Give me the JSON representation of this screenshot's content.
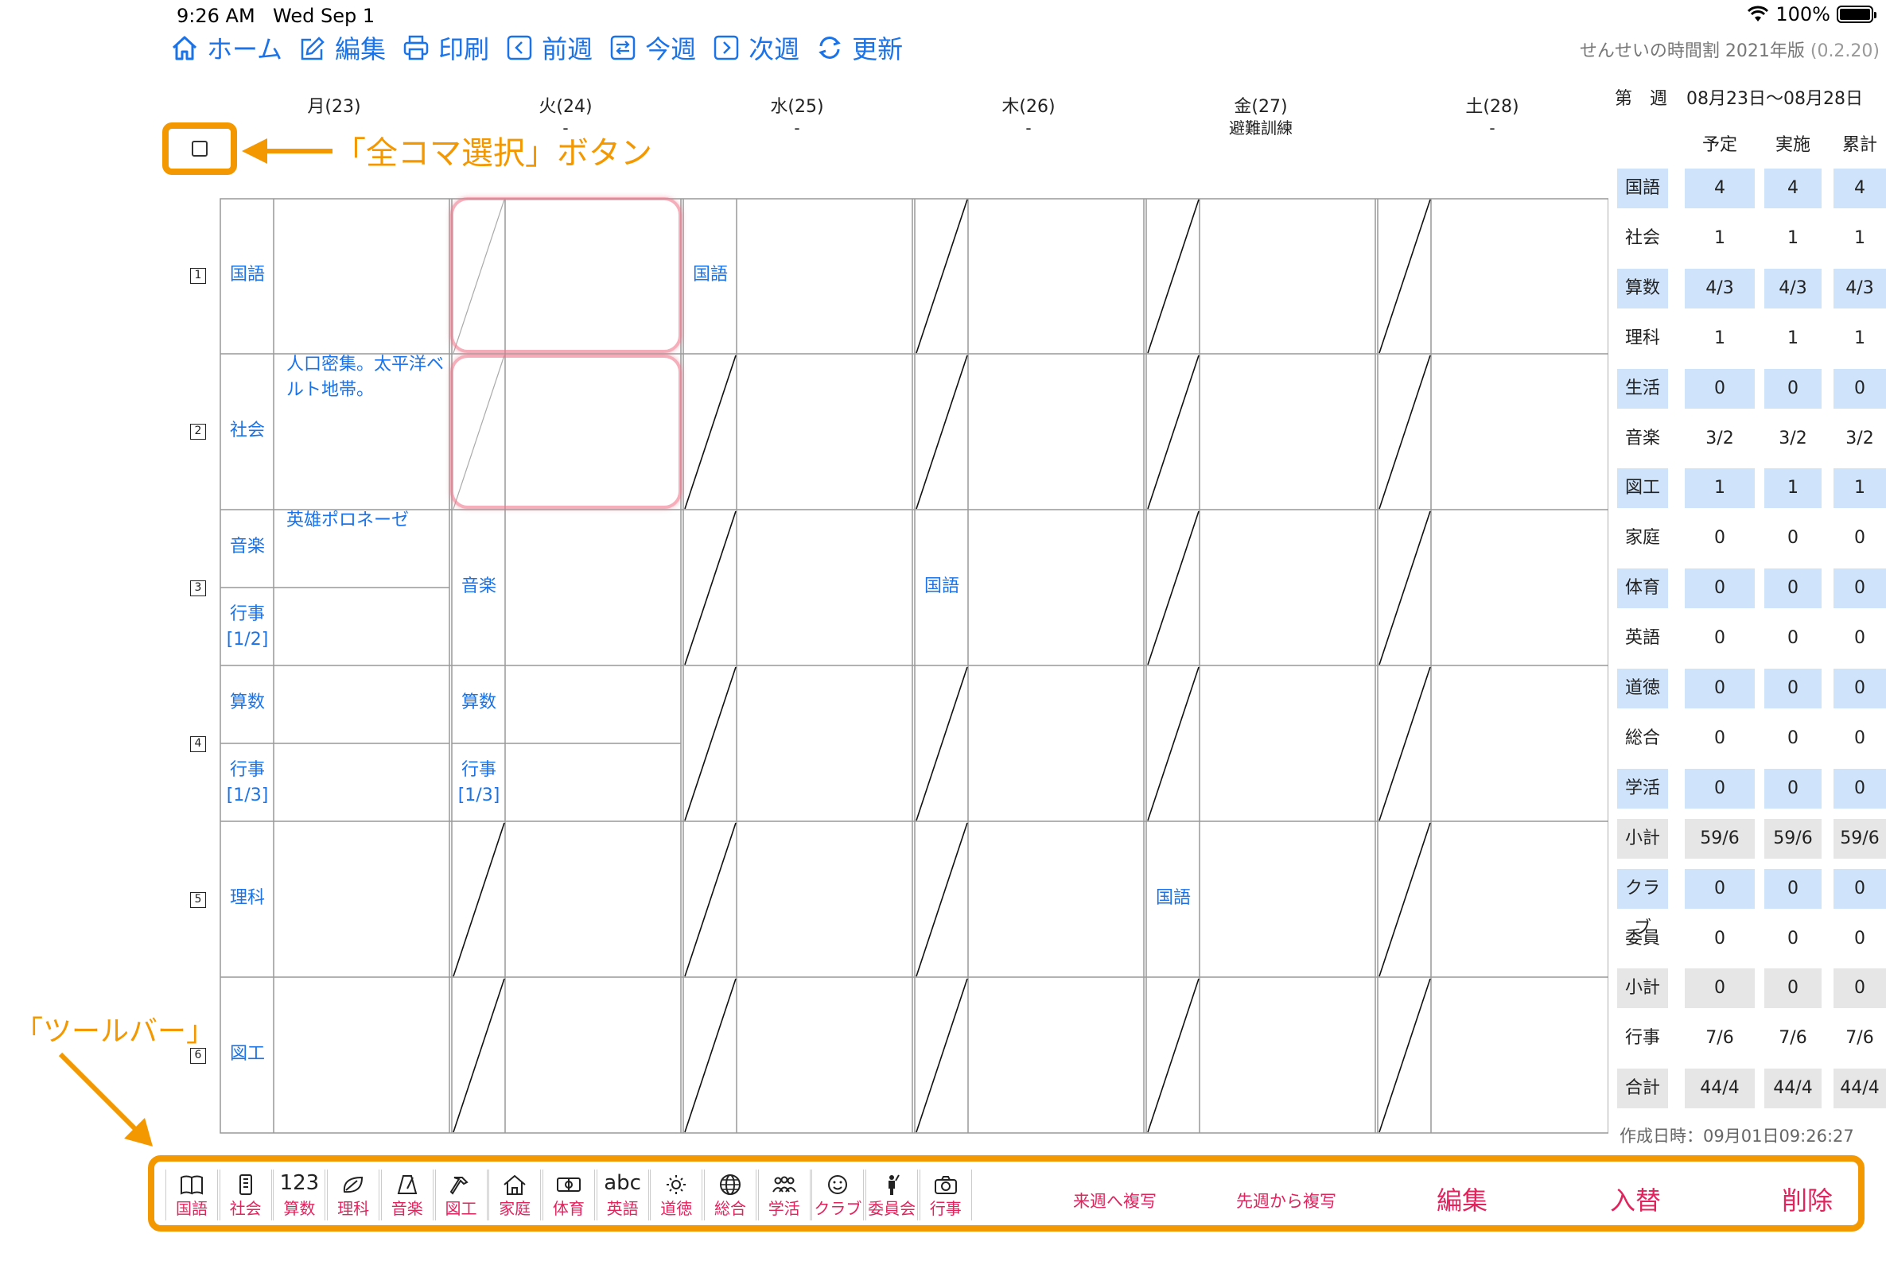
{
  "status": {
    "time": "9:26 AM",
    "date": "Wed Sep 1",
    "battery": "100%"
  },
  "nav": {
    "home": "ホーム",
    "edit": "編集",
    "print": "印刷",
    "prev": "前週",
    "this": "今週",
    "next": "次週",
    "refresh": "更新"
  },
  "app": {
    "name": "せんせいの時間割 2021年版",
    "version": "(0.2.20)"
  },
  "days": [
    {
      "label": "月(23)",
      "note": ""
    },
    {
      "label": "火(24)",
      "note": "-"
    },
    {
      "label": "水(25)",
      "note": "-"
    },
    {
      "label": "木(26)",
      "note": "-"
    },
    {
      "label": "金(27)",
      "note": "避難訓練"
    },
    {
      "label": "土(28)",
      "note": "-"
    }
  ],
  "annotations": {
    "select_all": "「全コマ選択」ボタン",
    "toolbar": "「ツールバー」"
  },
  "periods": [
    "1",
    "2",
    "3",
    "4",
    "5",
    "6"
  ],
  "cells": {
    "mon1": "国語",
    "mon2": "社会",
    "mon2_memo": "人口密集。太平洋ベルト地帯。",
    "mon3a": "音楽",
    "mon3a_memo": "英雄ポロネーゼ",
    "mon3b": "行事\n[1/2]",
    "mon4a": "算数",
    "mon4b": "行事\n[1/3]",
    "mon5": "理科",
    "mon6": "図工",
    "tue3": "音楽",
    "tue4a": "算数",
    "tue4b": "行事\n[1/3]",
    "wed1": "国語",
    "thu3": "国語",
    "fri5": "国語"
  },
  "summary": {
    "week_label": "第　週",
    "week_range": "08月23日〜08月28日",
    "cols": [
      "予定",
      "実施",
      "累計"
    ],
    "rows": [
      {
        "label": "国語",
        "v": [
          "4",
          "4",
          "4"
        ],
        "style": "hl"
      },
      {
        "label": "社会",
        "v": [
          "1",
          "1",
          "1"
        ],
        "style": ""
      },
      {
        "label": "算数",
        "v": [
          "4/3",
          "4/3",
          "4/3"
        ],
        "style": "hl"
      },
      {
        "label": "理科",
        "v": [
          "1",
          "1",
          "1"
        ],
        "style": ""
      },
      {
        "label": "生活",
        "v": [
          "0",
          "0",
          "0"
        ],
        "style": "hl"
      },
      {
        "label": "音楽",
        "v": [
          "3/2",
          "3/2",
          "3/2"
        ],
        "style": ""
      },
      {
        "label": "図工",
        "v": [
          "1",
          "1",
          "1"
        ],
        "style": "hl"
      },
      {
        "label": "家庭",
        "v": [
          "0",
          "0",
          "0"
        ],
        "style": ""
      },
      {
        "label": "体育",
        "v": [
          "0",
          "0",
          "0"
        ],
        "style": "hl"
      },
      {
        "label": "英語",
        "v": [
          "0",
          "0",
          "0"
        ],
        "style": ""
      },
      {
        "label": "道徳",
        "v": [
          "0",
          "0",
          "0"
        ],
        "style": "hl"
      },
      {
        "label": "総合",
        "v": [
          "0",
          "0",
          "0"
        ],
        "style": ""
      },
      {
        "label": "学活",
        "v": [
          "0",
          "0",
          "0"
        ],
        "style": "hl"
      },
      {
        "label": "小計",
        "v": [
          "59/6",
          "59/6",
          "59/6"
        ],
        "style": "gr"
      },
      {
        "label": "クラブ",
        "v": [
          "0",
          "0",
          "0"
        ],
        "style": "hl"
      },
      {
        "label": "委員会",
        "v": [
          "0",
          "0",
          "0"
        ],
        "style": ""
      },
      {
        "label": "小計",
        "v": [
          "0",
          "0",
          "0"
        ],
        "style": "gr"
      },
      {
        "label": "行事",
        "v": [
          "7/6",
          "7/6",
          "7/6"
        ],
        "style": ""
      },
      {
        "label": "合計",
        "v": [
          "44/4",
          "44/4",
          "44/4"
        ],
        "style": "gr"
      }
    ],
    "created": "作成日時：09月01日09:26:27"
  },
  "toolbar": {
    "tools": [
      {
        "label": "国語",
        "icon": "book-icon"
      },
      {
        "label": "社会",
        "icon": "globe-book-icon"
      },
      {
        "label": "算数",
        "icon": "number-icon",
        "text": "123"
      },
      {
        "label": "理科",
        "icon": "leaf-icon"
      },
      {
        "label": "音楽",
        "icon": "metronome-icon"
      },
      {
        "label": "図工",
        "icon": "hammer-icon"
      },
      {
        "label": "家庭",
        "icon": "house-icon"
      },
      {
        "label": "体育",
        "icon": "field-icon"
      },
      {
        "label": "英語",
        "icon": "abc-icon",
        "text": "abc"
      },
      {
        "label": "道徳",
        "icon": "sun-icon"
      },
      {
        "label": "総合",
        "icon": "globe-icon"
      },
      {
        "label": "学活",
        "icon": "people-icon"
      },
      {
        "label": "クラブ",
        "icon": "smiley-icon"
      },
      {
        "label": "委員会",
        "icon": "person-icon"
      },
      {
        "label": "行事",
        "icon": "camera-icon"
      }
    ],
    "copy_to_next": "来週へ複写",
    "copy_from_prev": "先週から複写",
    "edit": "編集",
    "swap": "入替",
    "delete": "削除"
  },
  "colors": {
    "accent": "#1a73e8",
    "action": "#e0245e",
    "annotation": "#f39800",
    "highlight": "#cfe3fb"
  }
}
